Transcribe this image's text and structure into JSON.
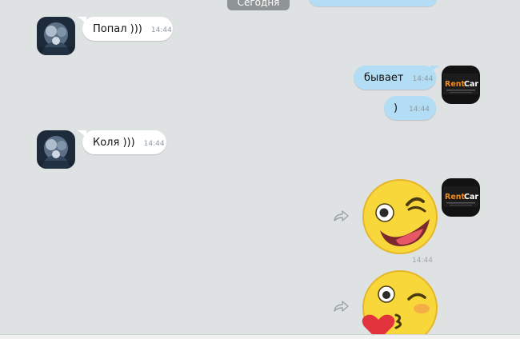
{
  "chat": {
    "date_separator": "Сегодня",
    "messages": [
      {
        "direction": "in",
        "sender": "user",
        "text": "Попал )))",
        "time": "14:44"
      },
      {
        "direction": "out",
        "sender": "rentcar",
        "text": "бывает",
        "time": "14:44"
      },
      {
        "direction": "out",
        "sender": "rentcar",
        "text": ")",
        "time": "14:44"
      },
      {
        "direction": "in",
        "sender": "user",
        "text": "Коля )))",
        "time": "14:44"
      },
      {
        "direction": "out",
        "sender": "rentcar",
        "sticker": "winking-laughing-emoji",
        "time": "14:44"
      },
      {
        "direction": "out",
        "sender": "rentcar",
        "sticker": "kissing-heart-emoji",
        "time": ""
      }
    ]
  },
  "brand": {
    "logo_text_1": "Rent",
    "logo_text_2": "Car",
    "accent_orange": "#f08a1c",
    "logo_bg": "#121212"
  },
  "colors": {
    "background": "#dfe2e2",
    "incoming_bubble": "#ffffff",
    "outgoing_bubble": "#b2ddf4",
    "date_pill": "#8f9595",
    "emoji_yellow": "#f8d73a"
  }
}
